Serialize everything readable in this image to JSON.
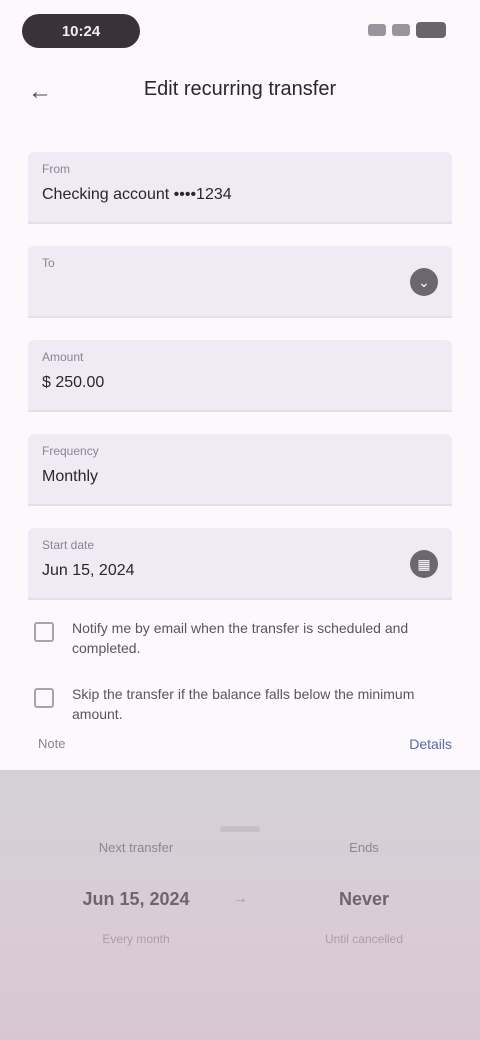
{
  "status": {
    "time": "10:24"
  },
  "app_bar": {
    "back_glyph": "←",
    "title": "Edit recurring transfer"
  },
  "form": {
    "fields": [
      {
        "label": "From",
        "value": "Checking account ••••1234",
        "trail": ""
      },
      {
        "label": "To",
        "value": "",
        "trail": "⌄"
      },
      {
        "label": "Amount",
        "value": "$ 250.00",
        "trail": ""
      },
      {
        "label": "Frequency",
        "value": "Monthly",
        "trail": ""
      },
      {
        "label": "Start date",
        "value": "Jun 15, 2024",
        "trail": "▦"
      }
    ]
  },
  "options": [
    {
      "text": "Notify me by email when the transfer is scheduled and completed."
    },
    {
      "text": "Skip the transfer if the balance falls below the minimum amount."
    }
  ],
  "link_row": {
    "small": "Note",
    "link": "Details"
  },
  "sheet": {
    "left": {
      "caption": "Next transfer",
      "main": "Jun 15, 2024",
      "sub": "Every month"
    },
    "separator": "→",
    "right": {
      "caption": "Ends",
      "main": "Never",
      "sub": "Until cancelled"
    }
  }
}
